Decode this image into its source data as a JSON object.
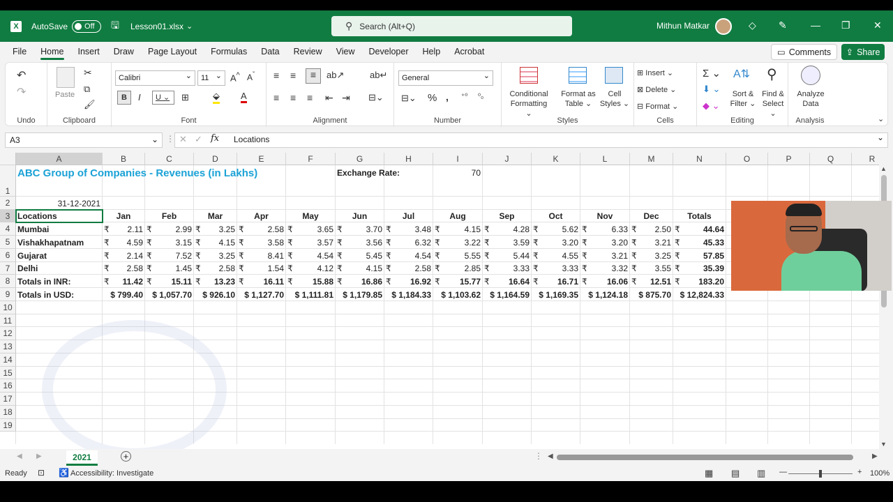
{
  "titlebar": {
    "autosave_label": "AutoSave",
    "autosave_state": "Off",
    "filename": "Lesson01.xlsx",
    "search_placeholder": "Search (Alt+Q)",
    "user_name": "Mithun Matkar"
  },
  "menu": {
    "tabs": [
      "File",
      "Home",
      "Insert",
      "Draw",
      "Page Layout",
      "Formulas",
      "Data",
      "Review",
      "View",
      "Developer",
      "Help",
      "Acrobat"
    ],
    "active": "Home",
    "comments_label": "Comments",
    "share_label": "Share"
  },
  "ribbon": {
    "undo_label": "Undo",
    "clipboard_label": "Clipboard",
    "paste_label": "Paste",
    "font_label": "Font",
    "font_name": "Calibri",
    "font_size": "11",
    "alignment_label": "Alignment",
    "number_label": "Number",
    "number_format": "General",
    "styles_label": "Styles",
    "conditional_formatting": [
      "Conditional",
      "Formatting"
    ],
    "format_as_table": [
      "Format as",
      "Table"
    ],
    "cell_styles": [
      "Cell",
      "Styles"
    ],
    "cells_label": "Cells",
    "insert_label": "Insert",
    "delete_label": "Delete",
    "format_label": "Format",
    "editing_label": "Editing",
    "sort_filter": [
      "Sort &",
      "Filter"
    ],
    "find_select": [
      "Find &",
      "Select"
    ],
    "analysis_label": "Analysis",
    "analyze_data": [
      "Analyze",
      "Data"
    ]
  },
  "formula_bar": {
    "name_box": "A3",
    "fx": "fx",
    "value": "Locations"
  },
  "sheet": {
    "columns": [
      "A",
      "B",
      "C",
      "D",
      "E",
      "F",
      "G",
      "H",
      "I",
      "J",
      "K",
      "L",
      "M",
      "N",
      "O",
      "P",
      "Q",
      "R"
    ],
    "rows": [
      "1",
      "2",
      "3",
      "4",
      "5",
      "6",
      "7",
      "8",
      "9",
      "10",
      "11",
      "12",
      "13",
      "14",
      "15",
      "16",
      "17",
      "18",
      "19"
    ],
    "title": "ABC Group of Companies - Revenues (in Lakhs)",
    "exchange_label": "Exchange Rate:",
    "exchange_value": "70",
    "date": "31-12-2021",
    "header_row": [
      "Locations",
      "Jan",
      "Feb",
      "Mar",
      "Apr",
      "May",
      "Jun",
      "Jul",
      "Aug",
      "Sep",
      "Oct",
      "Nov",
      "Dec",
      "Totals"
    ],
    "rupee": "₹",
    "data_rows": [
      {
        "label": "Mumbai",
        "values": [
          "2.11",
          "2.99",
          "3.25",
          "2.58",
          "3.65",
          "3.70",
          "3.48",
          "4.15",
          "4.28",
          "5.62",
          "6.33",
          "2.50"
        ],
        "total": "44.64"
      },
      {
        "label": "Vishakhapatnam",
        "values": [
          "4.59",
          "3.15",
          "4.15",
          "3.58",
          "3.57",
          "3.56",
          "6.32",
          "3.22",
          "3.59",
          "3.20",
          "3.20",
          "3.21"
        ],
        "total": "45.33"
      },
      {
        "label": "Gujarat",
        "values": [
          "2.14",
          "7.52",
          "3.25",
          "8.41",
          "4.54",
          "5.45",
          "4.54",
          "5.55",
          "5.44",
          "4.55",
          "3.21",
          "3.25"
        ],
        "total": "57.85"
      },
      {
        "label": "Delhi",
        "values": [
          "2.58",
          "1.45",
          "2.58",
          "1.54",
          "4.12",
          "4.15",
          "2.58",
          "2.85",
          "3.33",
          "3.33",
          "3.32",
          "3.55"
        ],
        "total": "35.39"
      }
    ],
    "inr_row": {
      "label": "Totals in INR:",
      "values": [
        "11.42",
        "15.11",
        "13.23",
        "16.11",
        "15.88",
        "16.86",
        "16.92",
        "15.77",
        "16.64",
        "16.71",
        "16.06",
        "12.51"
      ],
      "total": "183.20"
    },
    "usd_row": {
      "label": "Totals in USD:",
      "values": [
        "$ 799.40",
        "$ 1,057.70",
        "$ 926.10",
        "$ 1,127.70",
        "$ 1,111.81",
        "$ 1,179.85",
        "$ 1,184.33",
        "$ 1,103.62",
        "$ 1,164.59",
        "$ 1,169.35",
        "$ 1,124.18",
        "$ 875.70"
      ],
      "total": "$ 12,824.33"
    }
  },
  "sheet_tabs": {
    "active": "2021"
  },
  "status": {
    "ready": "Ready",
    "accessibility": "Accessibility: Investigate",
    "zoom": "100%"
  },
  "colors": {
    "accent": "#107c41",
    "title_text": "#1aa2d6"
  }
}
